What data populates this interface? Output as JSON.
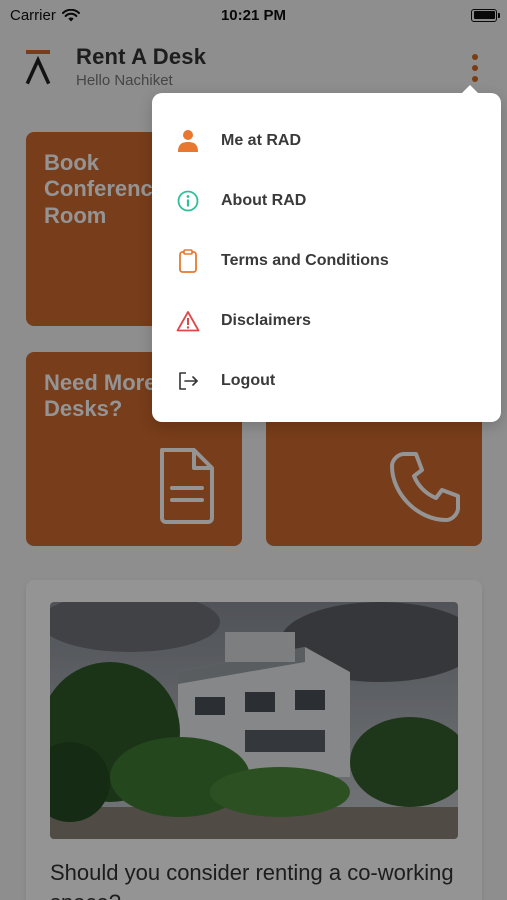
{
  "status_bar": {
    "carrier": "Carrier",
    "time": "10:21 PM"
  },
  "header": {
    "title": "Rent A Desk",
    "subtitle": "Hello Nachiket"
  },
  "tiles": [
    {
      "title": "Book\nConference\nRoom"
    },
    {
      "title": ""
    },
    {
      "title": "Need More\nDesks?"
    },
    {
      "title": ""
    }
  ],
  "blog": {
    "title": "Should you consider renting a co-working space?"
  },
  "menu": {
    "items": [
      {
        "label": "Me at RAD",
        "icon": "person-icon"
      },
      {
        "label": "About RAD",
        "icon": "info-icon"
      },
      {
        "label": "Terms and Conditions",
        "icon": "clipboard-icon"
      },
      {
        "label": "Disclaimers",
        "icon": "warning-icon"
      },
      {
        "label": "Logout",
        "icon": "logout-icon"
      }
    ]
  },
  "colors": {
    "accent": "#cf6a2d",
    "info": "#2fbf9b",
    "warning": "#e04848",
    "text": "#333333"
  }
}
